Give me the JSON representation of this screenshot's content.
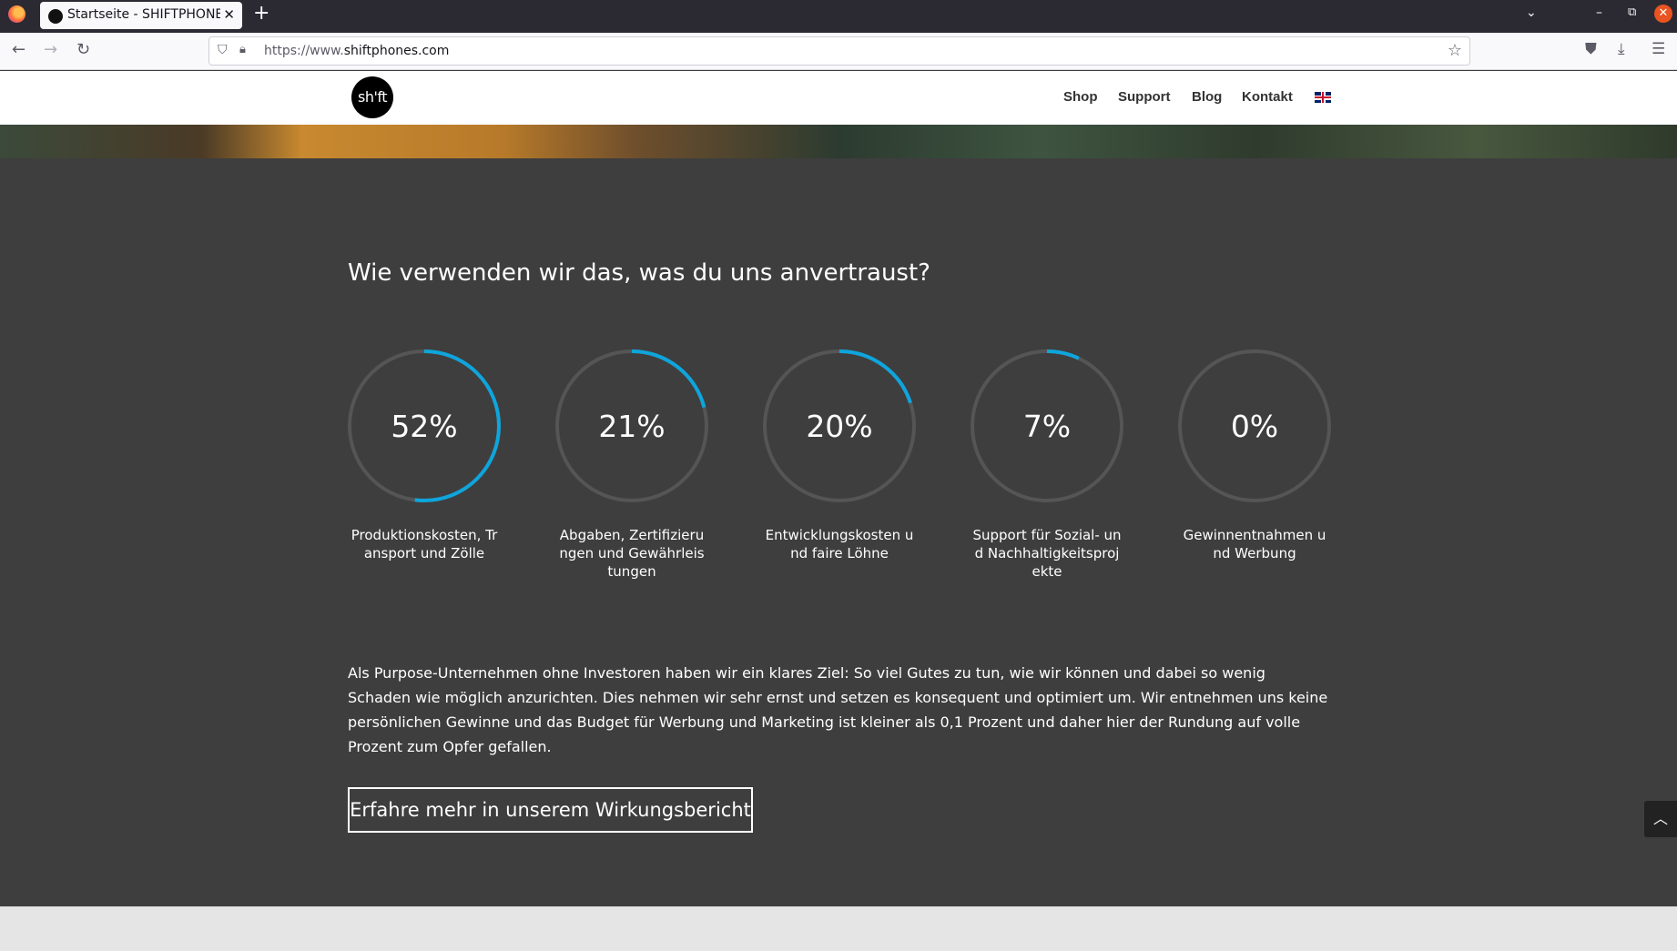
{
  "browser": {
    "tab_title": "Startseite - SHIFTPHONES",
    "tab_close": "✕",
    "new_tab": "+",
    "url_prefix": "https://www.",
    "url_domain": "shiftphones.com",
    "icons": [
      "firefox-logo",
      "back-arrow",
      "forward-arrow",
      "reload",
      "shield",
      "lock",
      "star",
      "pocket",
      "download",
      "menu",
      "list-tabs",
      "minimize",
      "maximize",
      "close"
    ]
  },
  "site": {
    "logo_text": "sh'ft",
    "menu": [
      "Shop",
      "Support",
      "Blog",
      "Kontakt"
    ],
    "language_flag": "uk-flag"
  },
  "main": {
    "heading": "Wie verwenden wir das, was du uns anvertraust?",
    "stats": [
      {
        "value": "52%",
        "fraction": 0.52,
        "label": "Produktionskosten, Transport und Zölle"
      },
      {
        "value": "21%",
        "fraction": 0.21,
        "label": "Abgaben, Zertifizierungen und Gewährleistungen"
      },
      {
        "value": "20%",
        "fraction": 0.2,
        "label": "Entwicklungskosten und faire Löhne"
      },
      {
        "value": "7%",
        "fraction": 0.07,
        "label": "Support für Sozial- und Nachhaltigkeitsprojekte"
      },
      {
        "value": "0%",
        "fraction": 0.0,
        "label": "Gewinnentnahmen und Werbung"
      }
    ],
    "paragraph": "Als Purpose-Unternehmen ohne Investoren haben wir ein klares Ziel: So viel Gutes zu tun, wie wir können und dabei so wenig Schaden wie möglich anzurichten. Dies nehmen wir sehr ernst und setzen es konsequent und optimiert um. Wir entnehmen uns keine persönlichen Gewinne und das Budget für Werbung und Marketing ist kleiner als 0,1 Prozent und daher hier der Rundung auf volle Prozent zum Opfer gefallen.",
    "cta_label": "Erfahre mehr in unserem Wirkungsbericht"
  },
  "colors": {
    "ring_accent": "#0ea5dd",
    "ring_track": "#555555",
    "background": "#3e3e3e"
  }
}
